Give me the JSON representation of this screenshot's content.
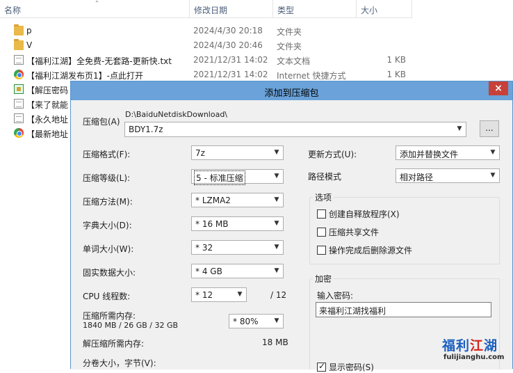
{
  "explorer": {
    "columns": {
      "name": "名称",
      "date": "修改日期",
      "type": "类型",
      "size": "大小"
    },
    "files": [
      {
        "name": "p",
        "date": "2024/4/30 20:18",
        "type": "文件夹",
        "size": "",
        "icon": "folder-icon"
      },
      {
        "name": "V",
        "date": "2024/4/30 20:46",
        "type": "文件夹",
        "size": "",
        "icon": "folder-icon"
      },
      {
        "name": "【福利江湖】全免费-无套路-更新快.txt",
        "date": "2021/12/31 14:02",
        "type": "文本文档",
        "size": "1 KB",
        "icon": "text-file-icon"
      },
      {
        "name": "【福利江湖发布页1】-点此打开",
        "date": "2021/12/31 14:02",
        "type": "Internet 快捷方式",
        "size": "1 KB",
        "icon": "internet-shortcut-icon"
      },
      {
        "name": "【解压密码",
        "date": "",
        "type": "",
        "size": "",
        "icon": "application-icon"
      },
      {
        "name": "【来了就能",
        "date": "",
        "type": "",
        "size": "",
        "icon": "text-file-icon"
      },
      {
        "name": "【永久地址",
        "date": "",
        "type": "",
        "size": "",
        "icon": "text-file-icon"
      },
      {
        "name": "【最新地址",
        "date": "",
        "type": "",
        "size": "",
        "icon": "internet-shortcut-icon"
      }
    ]
  },
  "dialog": {
    "title": "添加到压缩包",
    "close": "×",
    "archive": {
      "label": "压缩包(A)",
      "dir": "D:\\BaiduNetdiskDownload\\",
      "value": "BDY1.7z",
      "browse": "..."
    },
    "left": {
      "format": {
        "label": "压缩格式(F):",
        "value": "7z"
      },
      "level": {
        "label": "压缩等级(L):",
        "value": "5 - 标准压缩"
      },
      "method": {
        "label": "压缩方法(M):",
        "value": "* LZMA2"
      },
      "dict": {
        "label": "字典大小(D):",
        "value": "* 16 MB"
      },
      "word": {
        "label": "单词大小(W):",
        "value": "* 32"
      },
      "solid": {
        "label": "固实数据大小:",
        "value": "* 4 GB"
      },
      "threads": {
        "label": "CPU 线程数:",
        "value": "* 12",
        "max": "/ 12"
      },
      "memory": {
        "label": "压缩所需内存:",
        "detail": "1840 MB / 26 GB / 32 GB",
        "value": "* 80%"
      },
      "decomp": {
        "label": "解压缩所需内存:",
        "value": "18 MB"
      },
      "volume": {
        "label": "分卷大小，字节(V):"
      }
    },
    "right": {
      "update": {
        "label": "更新方式(U):",
        "value": "添加并替换文件"
      },
      "path": {
        "label": "路径模式",
        "value": "相对路径"
      },
      "options": {
        "title": "选项",
        "items": [
          {
            "label": "创建自释放程序(X)",
            "checked": false
          },
          {
            "label": "压缩共享文件",
            "checked": false
          },
          {
            "label": "操作完成后删除源文件",
            "checked": false
          }
        ]
      },
      "encryption": {
        "title": "加密",
        "pw_label": "输入密码:",
        "pw_value": "来福利江湖找福利",
        "show_label": "显示密码(S)",
        "show_checked": true
      }
    }
  },
  "watermark": {
    "logo_blue1": "福利",
    "logo_red": "江",
    "logo_blue2": "湖",
    "url": "fulijianghu.com"
  }
}
